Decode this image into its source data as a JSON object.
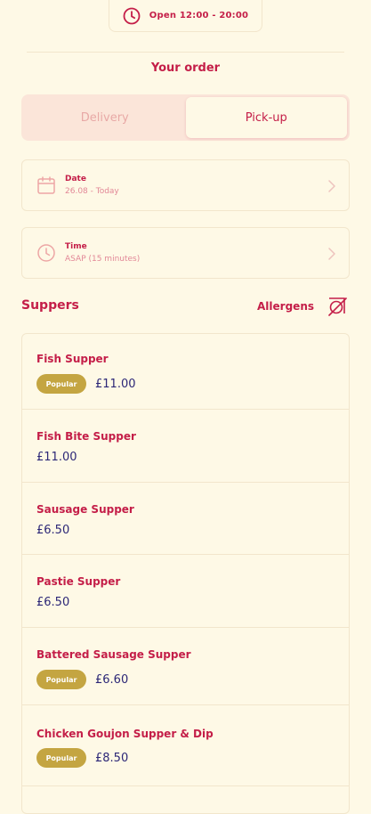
{
  "store": {
    "hours": "Open 12:00 - 20:00"
  },
  "order": {
    "heading": "Your order",
    "modes": [
      {
        "label": "Delivery",
        "active": false
      },
      {
        "label": "Pick-up",
        "active": true
      }
    ],
    "date": {
      "label": "Date",
      "value": "26.08 - Today"
    },
    "time": {
      "label": "Time",
      "value": "ASAP (15 minutes)"
    }
  },
  "menu": {
    "section_title": "Suppers",
    "allergens_label": "Allergens",
    "popular_label": "Popular",
    "items": [
      {
        "name": "Fish Supper",
        "price": "£11.00",
        "popular": true
      },
      {
        "name": "Fish Bite Supper",
        "price": "£11.00",
        "popular": false
      },
      {
        "name": "Sausage Supper",
        "price": "£6.50",
        "popular": false
      },
      {
        "name": "Pastie Supper",
        "price": "£6.50",
        "popular": false
      },
      {
        "name": "Battered Sausage Supper",
        "price": "£6.60",
        "popular": true
      },
      {
        "name": "Chicken Goujon Supper & Dip",
        "price": "£8.50",
        "popular": true
      }
    ]
  },
  "colors": {
    "background": "#FEF9E6",
    "accent": "#C41E48",
    "price": "#2C2777",
    "badge": "#C4A541",
    "toggle_bg": "#FBE5D9",
    "border": "#F2E6CC"
  }
}
